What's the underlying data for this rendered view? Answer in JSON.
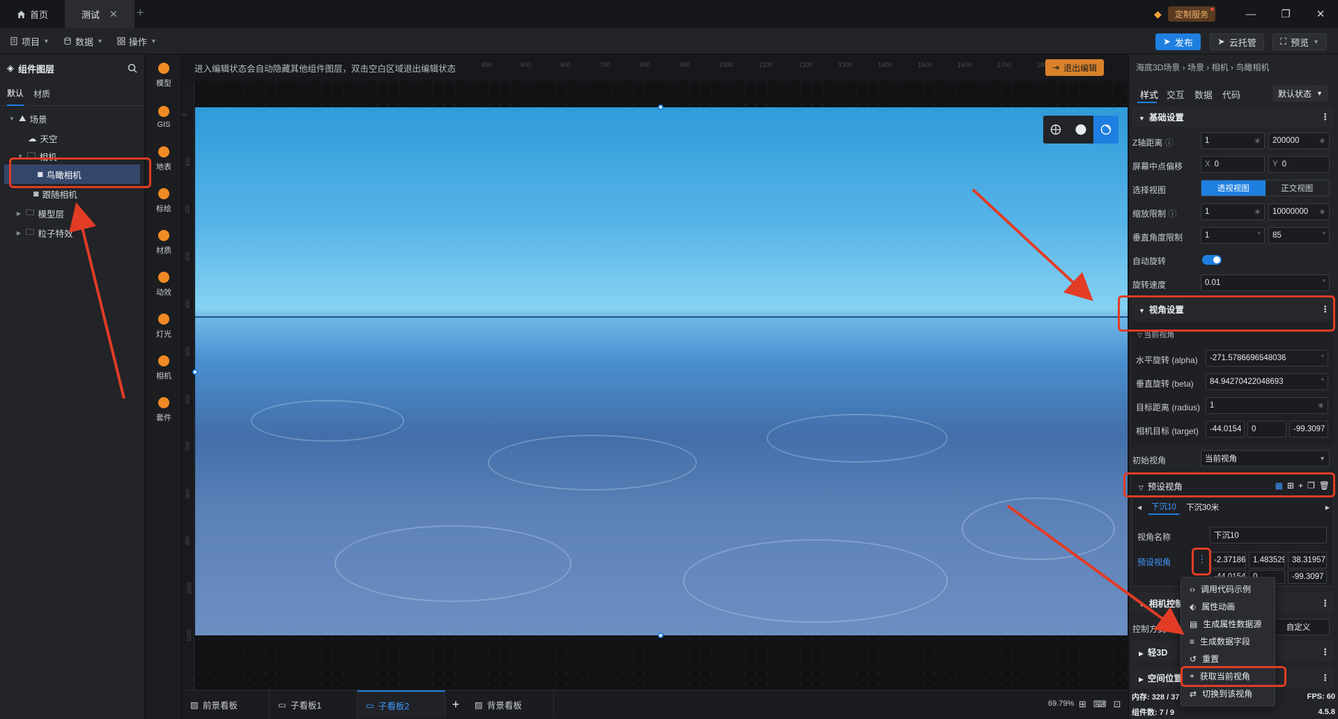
{
  "titlebar": {
    "tabs": [
      {
        "label": "首页",
        "icon": "home-icon"
      },
      {
        "label": "测试",
        "icon": "",
        "closable": true
      }
    ],
    "service_label": "定制服务"
  },
  "menubar": {
    "menus": [
      {
        "label": "项目",
        "icon": "document-icon"
      },
      {
        "label": "数据",
        "icon": "database-icon"
      },
      {
        "label": "操作",
        "icon": "grid-icon"
      }
    ],
    "publish_label": "发布",
    "cloud_label": "云托管",
    "preview_label": "预览"
  },
  "layers": {
    "title": "组件图层",
    "tabs": [
      "默认",
      "材质"
    ],
    "tree": {
      "scene": "场景",
      "sky": "天空",
      "camera_group": "相机",
      "bird_camera": "鸟瞰相机",
      "follow_camera": "跟随相机",
      "model_layer": "模型层",
      "particle": "粒子特效"
    }
  },
  "iconbar": [
    "模型",
    "GIS",
    "地表",
    "标绘",
    "材质",
    "动效",
    "灯光",
    "相机",
    "套件"
  ],
  "canvas": {
    "tip": "进入编辑状态会自动隐藏其他组件图层，双击空白区域退出编辑状态",
    "exit_label": "退出编辑",
    "ruler_top": [
      "400",
      "500",
      "600",
      "700",
      "800",
      "900",
      "1000",
      "1100",
      "1200",
      "1300",
      "1400",
      "1500",
      "1600",
      "1700",
      "1800"
    ],
    "ruler_left": [
      "0",
      "100",
      "200",
      "300",
      "400",
      "500",
      "600",
      "700",
      "800",
      "900",
      "1000",
      "1100"
    ]
  },
  "bottom": {
    "tabs": [
      "前景看板",
      "子看板1",
      "子看板2",
      "背景看板"
    ],
    "active_tab": "子看板2",
    "zoom": "69.79%"
  },
  "props": {
    "breadcrumb": "海底3D场景 › 场景 › 相机 › 鸟瞰相机",
    "tabs": [
      "样式",
      "交互",
      "数据",
      "代码"
    ],
    "state": "默认状态",
    "basic": {
      "title": "基础设置",
      "z_label": "Z轴距离",
      "z_min": "1",
      "z_max": "200000",
      "offset_label": "屏幕中点偏移",
      "offset_x_prefix": "X",
      "offset_x": "0",
      "offset_y_prefix": "Y",
      "offset_y": "0",
      "view_label": "选择视图",
      "view_options": [
        "透视视图",
        "正交视图"
      ],
      "scale_label": "缩放限制",
      "scale_min": "1",
      "scale_max": "10000000",
      "vangle_label": "垂直角度限制",
      "vangle_min": "1",
      "vangle_max": "85",
      "autorotate_label": "自动旋转",
      "speed_label": "旋转速度",
      "speed_value": "0.01"
    },
    "viewangle": {
      "title": "视角设置",
      "current_view": "当前视角",
      "alpha_label": "水平旋转 (alpha)",
      "alpha_value": "-271.5786696548036",
      "beta_label": "垂直旋转 (beta)",
      "beta_value": "84.94270422048693",
      "radius_label": "目标距离 (radius)",
      "radius_value": "1",
      "target_label": "相机目标 (target)",
      "target_x": "-44.0154",
      "target_y": "0",
      "target_z": "-99.3097",
      "init_label": "初始视角",
      "init_value": "当前视角"
    },
    "preset": {
      "title": "预设视角",
      "tabs": [
        "下沉10",
        "下沉30米"
      ],
      "name_label": "视角名称",
      "name_value": "下沉10",
      "preset_label": "预设视角",
      "values_row1": [
        "-2.37186",
        "1.483529",
        "38.31957"
      ],
      "values_row2": [
        "-44.0154",
        "0",
        "-99.3097"
      ]
    },
    "camctrl": {
      "title": "相机控制",
      "mode_label": "控制方式",
      "mode_value": "自定义"
    },
    "light3d": "轻3D",
    "spatial": "空间位置",
    "status": {
      "memory_label": "内存:",
      "memory_value": "328 / 37",
      "fps_label": "FPS:",
      "fps_value": "60",
      "components_label": "组件数:",
      "components_value": "7 / 9",
      "version": "4.5.8"
    }
  },
  "context_menu": [
    "调用代码示例",
    "属性动画",
    "生成属性数据源",
    "生成数据字段",
    "重置",
    "获取当前视角",
    "切换到该视角"
  ],
  "colors": {
    "accent": "#1f7fe0",
    "annotation": "#e23c25",
    "exit": "#d9822b"
  }
}
